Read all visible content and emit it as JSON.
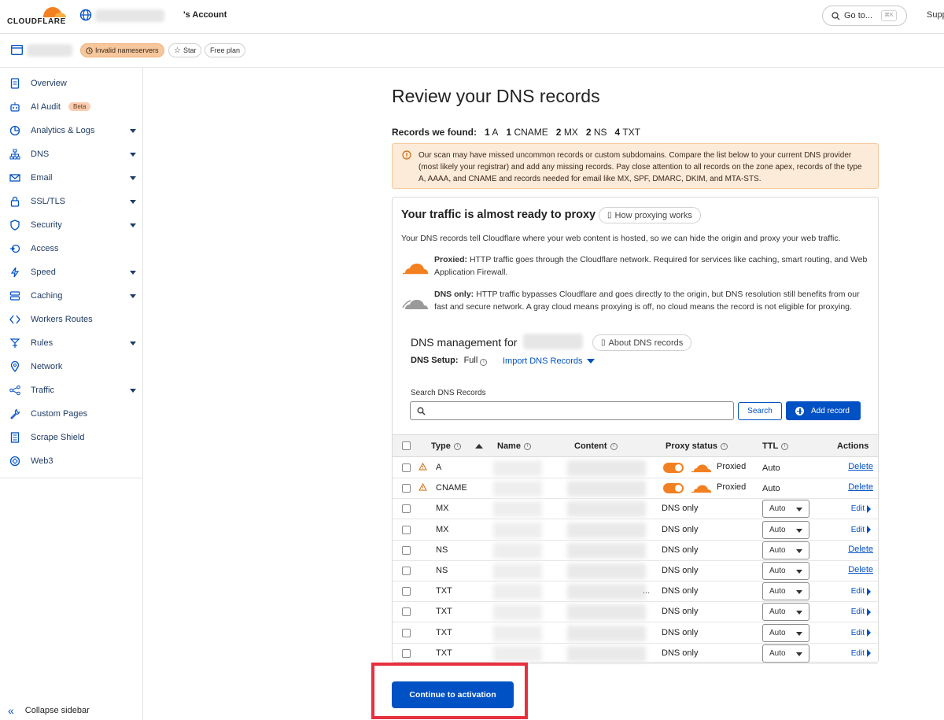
{
  "topbar": {
    "brand": "CLOUDFLARE",
    "account_suffix": "'s Account",
    "goto_label": "Go to...",
    "goto_shortcut": "⌘K",
    "support_label": "Supp"
  },
  "zonebar": {
    "status_badge": "Invalid nameservers",
    "star_label": "Star",
    "plan_label": "Free plan"
  },
  "sidebar": {
    "items": [
      {
        "label": "Overview",
        "icon": "document-icon",
        "caret": false
      },
      {
        "label": "AI Audit",
        "icon": "robot-icon",
        "caret": false,
        "badge": "Beta"
      },
      {
        "label": "Analytics & Logs",
        "icon": "pie-chart-icon",
        "caret": true
      },
      {
        "label": "DNS",
        "icon": "sitemap-icon",
        "caret": true
      },
      {
        "label": "Email",
        "icon": "envelope-icon",
        "caret": true
      },
      {
        "label": "SSL/TLS",
        "icon": "lock-icon",
        "caret": true
      },
      {
        "label": "Security",
        "icon": "shield-icon",
        "caret": true
      },
      {
        "label": "Access",
        "icon": "access-icon",
        "caret": false
      },
      {
        "label": "Speed",
        "icon": "bolt-icon",
        "caret": true
      },
      {
        "label": "Caching",
        "icon": "server-icon",
        "caret": true
      },
      {
        "label": "Workers Routes",
        "icon": "workers-icon",
        "caret": false
      },
      {
        "label": "Rules",
        "icon": "rules-icon",
        "caret": true
      },
      {
        "label": "Network",
        "icon": "location-pin-icon",
        "caret": false
      },
      {
        "label": "Traffic",
        "icon": "traffic-icon",
        "caret": true
      },
      {
        "label": "Custom Pages",
        "icon": "wrench-icon",
        "caret": false
      },
      {
        "label": "Scrape Shield",
        "icon": "page-icon",
        "caret": false
      },
      {
        "label": "Web3",
        "icon": "web3-icon",
        "caret": false
      }
    ],
    "collapse_label": "Collapse sidebar"
  },
  "main": {
    "title": "Review your DNS records",
    "found_label": "Records we found:",
    "found_counts": [
      {
        "count": "1",
        "type": "A"
      },
      {
        "count": "1",
        "type": "CNAME"
      },
      {
        "count": "2",
        "type": "MX"
      },
      {
        "count": "2",
        "type": "NS"
      },
      {
        "count": "4",
        "type": "TXT"
      }
    ],
    "notice": "Our scan may have missed uncommon records or custom subdomains. Compare the list below to your current DNS provider (most likely your registrar) and add any missing records. Pay close attention to all records on the zone apex, records of the type A, AAAA, and CNAME and records needed for email like MX, SPF, DMARC, DKIM, and MTA-STS."
  },
  "proxy_card": {
    "title": "Your traffic is almost ready to proxy",
    "how_button": "How proxying works",
    "description": "Your DNS records tell Cloudflare where your web content is hosted, so we can hide the origin and proxy your web traffic.",
    "proxied_label": "Proxied:",
    "proxied_text": "HTTP traffic goes through the Cloudflare network. Required for services like caching, smart routing, and Web Application Firewall.",
    "dnsonly_label": "DNS only:",
    "dnsonly_text": "HTTP traffic bypasses Cloudflare and goes directly to the origin, but DNS resolution still benefits from our fast and secure network. A gray cloud means proxying is off, no cloud means the record is not eligible for proxying."
  },
  "dns_mgmt": {
    "title": "DNS management for",
    "about_button": "About DNS records",
    "setup_label": "DNS Setup:",
    "setup_value": "Full",
    "import_label": "Import DNS Records",
    "search_label": "Search DNS Records",
    "search_placeholder": "",
    "search_button": "Search",
    "add_button": "Add record"
  },
  "table": {
    "headers": {
      "type": "Type",
      "name": "Name",
      "content": "Content",
      "proxy": "Proxy status",
      "ttl": "TTL",
      "actions": "Actions"
    },
    "rows": [
      {
        "type": "A",
        "warn": true,
        "proxy": "Proxied",
        "ttl": "Auto",
        "ttl_select": false,
        "action": "Delete"
      },
      {
        "type": "CNAME",
        "warn": true,
        "proxy": "Proxied",
        "ttl": "Auto",
        "ttl_select": false,
        "action": "Delete"
      },
      {
        "type": "MX",
        "warn": false,
        "proxy": "DNS only",
        "ttl": "Auto",
        "ttl_select": true,
        "action": "Edit"
      },
      {
        "type": "MX",
        "warn": false,
        "proxy": "DNS only",
        "ttl": "Auto",
        "ttl_select": true,
        "action": "Edit"
      },
      {
        "type": "NS",
        "warn": false,
        "proxy": "DNS only",
        "ttl": "Auto",
        "ttl_select": true,
        "action": "Delete"
      },
      {
        "type": "NS",
        "warn": false,
        "proxy": "DNS only",
        "ttl": "Auto",
        "ttl_select": true,
        "action": "Delete"
      },
      {
        "type": "TXT",
        "warn": false,
        "proxy": "DNS only",
        "ttl": "Auto",
        "ttl_select": true,
        "action": "Edit",
        "ellipsis": "..."
      },
      {
        "type": "TXT",
        "warn": false,
        "proxy": "DNS only",
        "ttl": "Auto",
        "ttl_select": true,
        "action": "Edit"
      },
      {
        "type": "TXT",
        "warn": false,
        "proxy": "DNS only",
        "ttl": "Auto",
        "ttl_select": true,
        "action": "Edit"
      },
      {
        "type": "TXT",
        "warn": false,
        "proxy": "DNS only",
        "ttl": "Auto",
        "ttl_select": true,
        "action": "Edit"
      }
    ]
  },
  "continue_button": "Continue to activation",
  "colors": {
    "accent": "#0051c3",
    "orange": "#f38020",
    "highlight": "#e8303f"
  }
}
